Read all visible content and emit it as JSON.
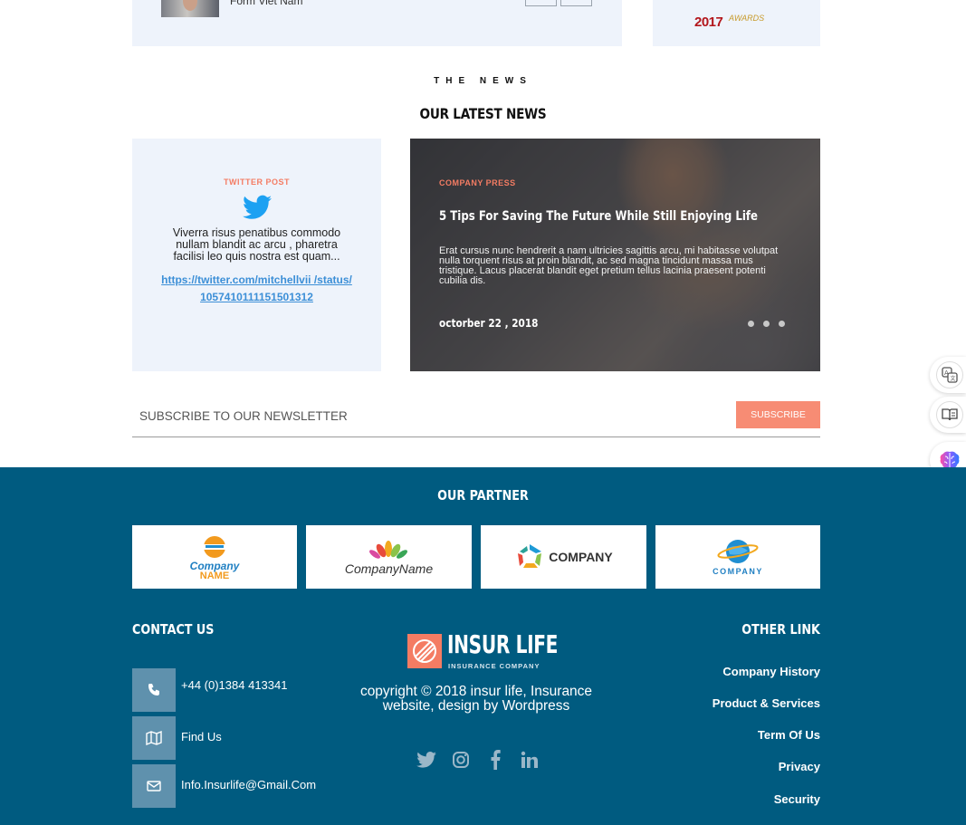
{
  "top": {
    "author_name": "Form Viet Nam",
    "award_year": "2017",
    "award_label": "AWARDS"
  },
  "news": {
    "eyebrow": "THE NEWS",
    "title": "OUR LATEST NEWS",
    "twitter_card": {
      "tag": "TWITTER POST",
      "text": "Viverra risus penatibus commodo nullam blandit ac arcu , pharetra facilisi leo quis nostra est quam...",
      "link_line1": "https://twitter.com/mitchellvii /status/",
      "link_line2": "1057410111151501312"
    },
    "feature_card": {
      "tag": "COMPANY PRESS",
      "title": "5 Tips For Saving The Future While Still Enjoying Life",
      "body": "Erat cursus nunc hendrerit a nam ultricies sagittis arcu, mi habitasse volutpat nulla torquent risus at proin blandit, ac sed magna tincidunt massa mus tristique. Lacus placerat blandit eget pretium tellus lacinia praesent potenti cubilia dis.",
      "date": "octorber 22 , 2018"
    }
  },
  "newsletter": {
    "placeholder": "SUBSCRIBE TO OUR NEWSLETTER",
    "button": "SUBSCRIBE"
  },
  "footer": {
    "partner_title": "OUR PARTNER",
    "partners": [
      {
        "line1": "Company",
        "line2": "NAME"
      },
      {
        "line1": "CompanyName"
      },
      {
        "line1": "COMPANY"
      },
      {
        "line1": "COMPANY"
      }
    ],
    "contact": {
      "title": "CONTACT US",
      "phone": "+44 (0)1384 413341",
      "find": "Find Us",
      "email": "Info.Insurlife@Gmail.Com"
    },
    "brand": {
      "name": "INSUR LIFE",
      "tagline": "INSURANCE COMPANY",
      "copyright": "copyright © 2018 insur life, Insurance website, design by Wordpress"
    },
    "socials": [
      "twitter-icon",
      "instagram-icon",
      "facebook-icon",
      "linkedin-icon"
    ],
    "other": {
      "title": "OTHER LINK",
      "links": [
        "Company History",
        "Product & Services",
        "Term Of Us",
        "Privacy",
        "Security"
      ]
    }
  },
  "colors": {
    "accent": "#f47c63",
    "footer_bg": "#005b80",
    "card_bg": "#eef3fb",
    "link": "#3c8fd7"
  }
}
